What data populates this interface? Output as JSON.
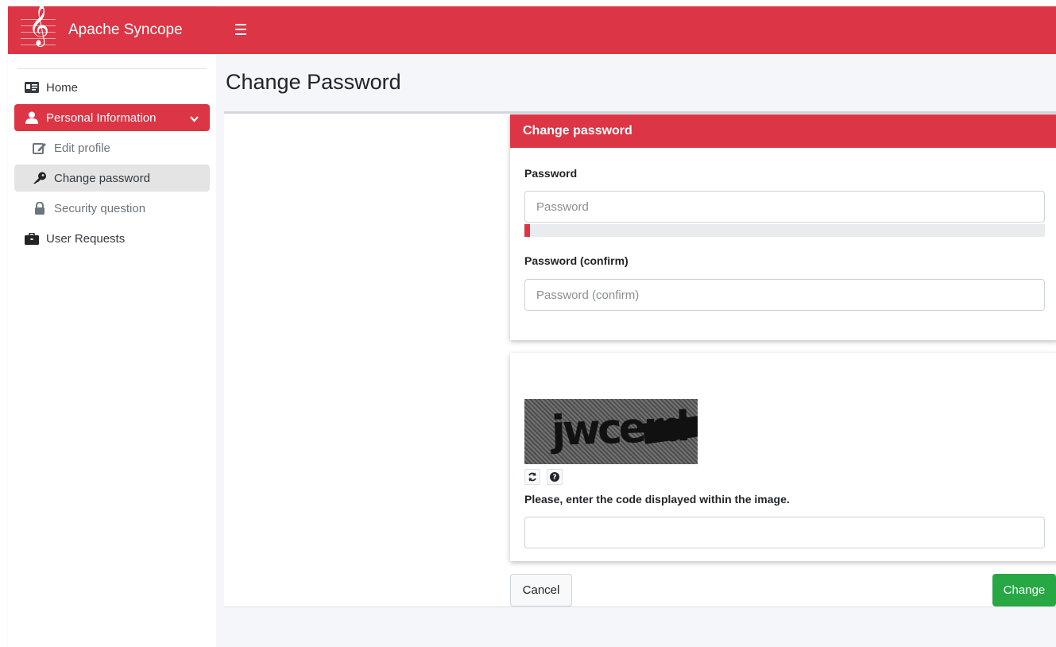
{
  "app": {
    "title": "Apache Syncope",
    "accent": "#dc3545",
    "logo_glyph": "𝄞"
  },
  "sidebar": {
    "items": [
      {
        "label": "Home",
        "icon": "id-card-icon"
      },
      {
        "label": "Personal Information",
        "icon": "user-icon",
        "expanded": true
      },
      {
        "label": "Edit profile",
        "icon": "edit-icon"
      },
      {
        "label": "Change password",
        "icon": "key-icon",
        "selected": true
      },
      {
        "label": "Security question",
        "icon": "lock-icon"
      },
      {
        "label": "User Requests",
        "icon": "briefcase-icon"
      }
    ]
  },
  "page": {
    "title": "Change Password"
  },
  "form": {
    "header": "Change password",
    "password_label": "Password",
    "password_placeholder": "Password",
    "password_value": "",
    "strength_percent": 1,
    "strength_color": "#dc3545",
    "confirm_label": "Password (confirm)",
    "confirm_placeholder": "Password (confirm)",
    "confirm_value": ""
  },
  "captcha": {
    "code_text": "jwcerd",
    "refresh_icon": "refresh-icon",
    "help_icon": "question-circle-icon",
    "help_glyph": "?",
    "instruction": "Please, enter the code displayed within the image.",
    "value": ""
  },
  "actions": {
    "cancel_label": "Cancel",
    "change_label": "Change",
    "change_color": "#28a745"
  }
}
